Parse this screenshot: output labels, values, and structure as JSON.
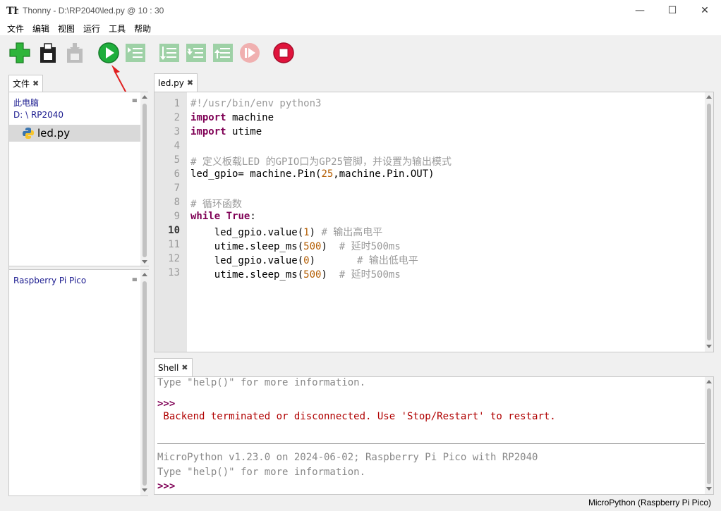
{
  "window": {
    "title": "Thonny  -  D:\\RP2040\\led.py  @  10 : 30",
    "minimize": "—",
    "maximize": "☐",
    "close": "✕"
  },
  "menu": [
    "文件",
    "编辑",
    "视图",
    "运行",
    "工具",
    "帮助"
  ],
  "toolbar": {
    "buttons": [
      "new-icon",
      "save-icon",
      "load-icon",
      "run-icon",
      "debug-icon",
      "step-over-icon",
      "step-into-icon",
      "step-out-icon",
      "resume-icon",
      "stop-icon"
    ]
  },
  "files_panel": {
    "tab_label": "文件",
    "this_pc_label": "此电脑",
    "path": "D: \\ RP2040",
    "file": "led.py",
    "device_label": "Raspberry Pi Pico",
    "menu_glyph": "≡"
  },
  "editor": {
    "tab_label": "led.py",
    "current_line": 10,
    "lines": [
      "#!/usr/bin/env python3",
      "import machine",
      "import utime",
      "",
      "# 定义板载LED 的GPIO口为GP25管脚，并设置为输出模式",
      "led_gpio= machine.Pin(25,machine.Pin.OUT)",
      "",
      "# 循环函数",
      "while True:",
      "    led_gpio.value(1) # 输出高电平",
      "    utime.sleep_ms(500)  # 延时500ms",
      "    led_gpio.value(0)       # 输出低电平",
      "    utime.sleep_ms(500)  # 延时500ms"
    ]
  },
  "shell": {
    "tab_label": "Shell",
    "line1": "Type \"help()\" for more information.",
    "prompt": ">>>",
    "error": " Backend terminated or disconnected. Use 'Stop/Restart' to restart.",
    "version": "MicroPython v1.23.0 on 2024-06-02; Raspberry Pi Pico with RP2040",
    "line2": "Type \"help()\" for more information."
  },
  "status": {
    "interpreter": "MicroPython (Raspberry Pi Pico)"
  },
  "colors": {
    "keyword": "#7f0055",
    "comment": "#999999",
    "number": "#b35c00",
    "error": "#b00000",
    "run_green": "#1fae3c",
    "stop_red": "#e0143c"
  }
}
